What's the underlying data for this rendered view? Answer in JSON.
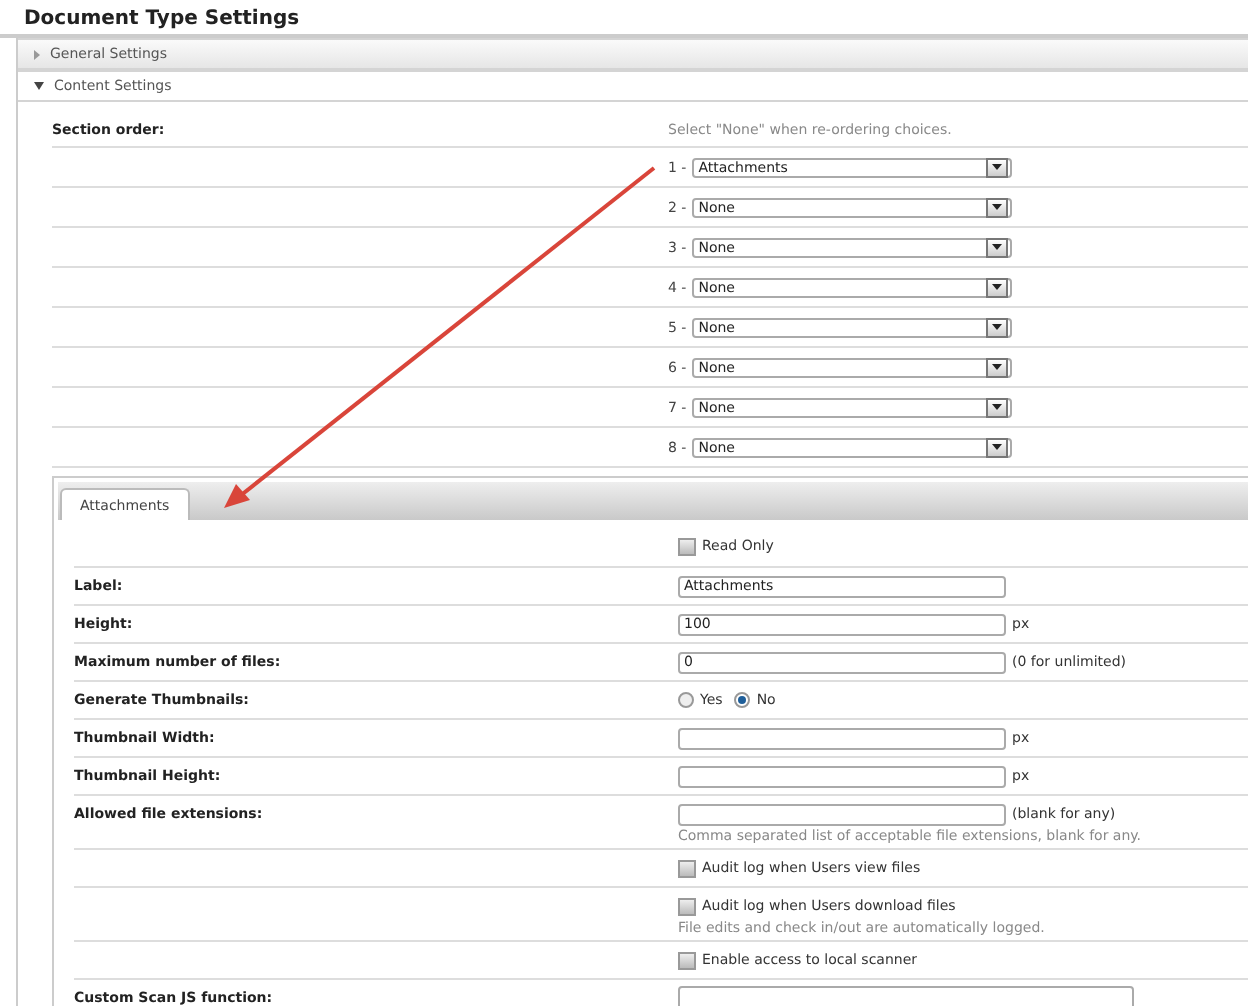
{
  "title": "Document Type Settings",
  "accordion": [
    {
      "label": "General Settings",
      "expanded": false
    },
    {
      "label": "Content Settings",
      "expanded": true
    }
  ],
  "section_order": {
    "label": "Section order:",
    "hint": "Select \"None\" when re-ordering choices.",
    "slots": [
      {
        "number": "1 -",
        "value": "Attachments"
      },
      {
        "number": "2 -",
        "value": "None"
      },
      {
        "number": "3 -",
        "value": "None"
      },
      {
        "number": "4 -",
        "value": "None"
      },
      {
        "number": "5 -",
        "value": "None"
      },
      {
        "number": "6 -",
        "value": "None"
      },
      {
        "number": "7 -",
        "value": "None"
      },
      {
        "number": "8 -",
        "value": "None"
      }
    ]
  },
  "tabs": [
    {
      "label": "Attachments",
      "selected": true
    }
  ],
  "form_rows": [
    {
      "kind": "checkbox",
      "text": "Read Only",
      "checked": false
    },
    {
      "kind": "text",
      "label": "Label:",
      "value": "Attachments"
    },
    {
      "kind": "text",
      "label": "Height:",
      "value": "100",
      "suffix": "px"
    },
    {
      "kind": "text",
      "label": "Maximum number of files:",
      "value": "0",
      "suffix": "(0 for unlimited)"
    },
    {
      "kind": "radio",
      "label": "Generate Thumbnails:",
      "options": [
        {
          "label": "Yes",
          "selected": false
        },
        {
          "label": "No",
          "selected": true
        }
      ]
    },
    {
      "kind": "text",
      "label": "Thumbnail Width:",
      "suffix": "px"
    },
    {
      "kind": "text",
      "label": "Thumbnail Height:",
      "suffix": "px"
    },
    {
      "kind": "text",
      "label": "Allowed file extensions:",
      "suffix": "(blank for any)",
      "note": "Comma separated list of acceptable file extensions, blank for any."
    },
    {
      "kind": "checkbox",
      "text": "Audit log when Users view files",
      "checked": false
    },
    {
      "kind": "checkbox",
      "text": "Audit log when Users download files",
      "checked": false,
      "note": "File edits and check in/out are automatically logged."
    },
    {
      "kind": "checkbox",
      "text": "Enable access to local scanner",
      "checked": false
    },
    {
      "kind": "textarea",
      "label": "Custom Scan JS function:"
    }
  ]
}
